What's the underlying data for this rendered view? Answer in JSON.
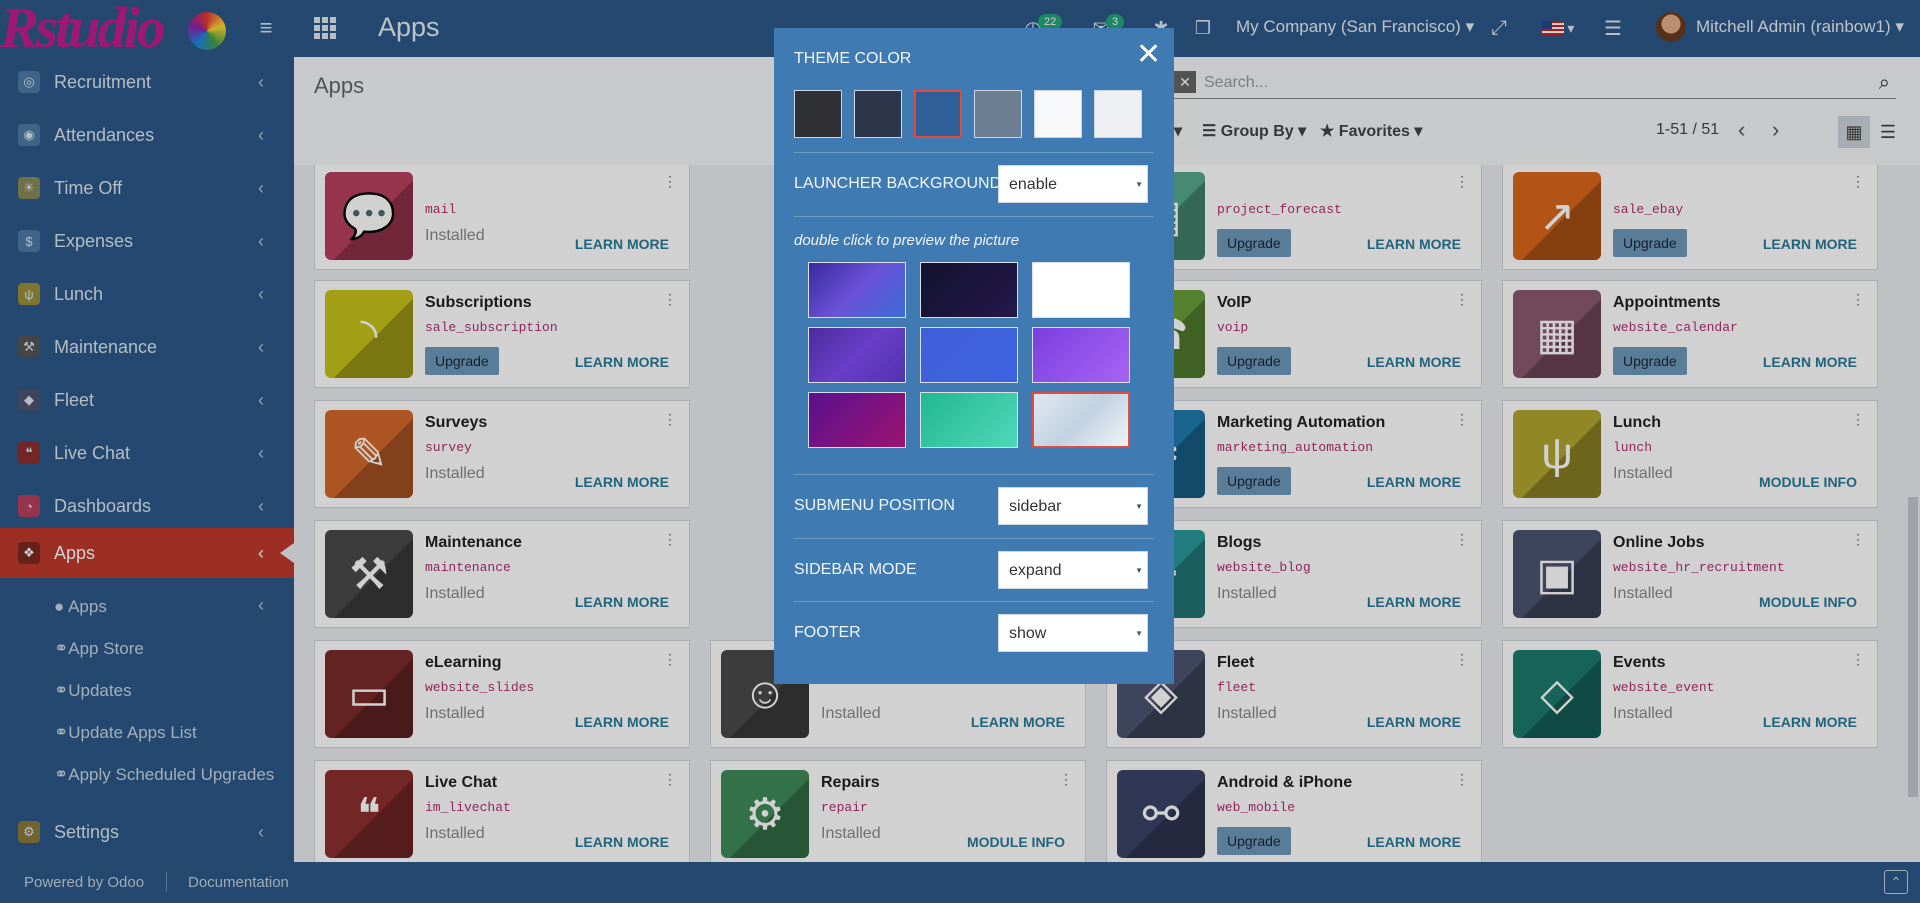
{
  "topbar": {
    "title": "Apps",
    "activity_count": "22",
    "messages_count": "3",
    "company": "My Company (San Francisco)",
    "user": "Mitchell Admin (rainbow1)",
    "logo_text": "Rstudio"
  },
  "sidebar": {
    "items": [
      {
        "label": "Recruitment",
        "icon": "recruitment-icon"
      },
      {
        "label": "Attendances",
        "icon": "attendances-icon"
      },
      {
        "label": "Time Off",
        "icon": "time-off-icon"
      },
      {
        "label": "Expenses",
        "icon": "expenses-icon"
      },
      {
        "label": "Lunch",
        "icon": "lunch-icon"
      },
      {
        "label": "Maintenance",
        "icon": "maintenance-icon"
      },
      {
        "label": "Fleet",
        "icon": "fleet-icon"
      },
      {
        "label": "Live Chat",
        "icon": "live-chat-icon"
      },
      {
        "label": "Dashboards",
        "icon": "dashboards-icon"
      },
      {
        "label": "Apps",
        "icon": "apps-icon"
      }
    ],
    "sub_items": [
      "Apps",
      "App Store",
      "Updates",
      "Update Apps List",
      "Apply Scheduled Upgrades"
    ],
    "settings": "Settings"
  },
  "control_panel": {
    "breadcrumb": "Apps",
    "search_placeholder": "Search...",
    "group_by": "Group By",
    "favorites": "Favorites",
    "pager": "1-51 / 51"
  },
  "apps": [
    {
      "name": "",
      "tech": "mail",
      "status": "Installed",
      "action": "LEARN MORE",
      "color": "#b83f5e",
      "icon": "chat-bubble-icon"
    },
    {
      "name": "",
      "tech": "project_forecast",
      "status": "Upgrade",
      "action": "LEARN MORE",
      "color": "#56a88e",
      "icon": "forecast-icon"
    },
    {
      "name": "",
      "tech": "sale_ebay",
      "status": "Upgrade",
      "action": "LEARN MORE",
      "color": "#d9671b",
      "icon": "chart-up-icon"
    },
    {
      "name": "Subscriptions",
      "tech": "sale_subscription",
      "status": "Upgrade",
      "action": "LEARN MORE",
      "color": "#c7c21a",
      "icon": "rss-icon"
    },
    {
      "name": "VoIP",
      "tech": "voip",
      "status": "Upgrade",
      "action": "LEARN MORE",
      "color": "#6a9f3a",
      "icon": "phone-icon"
    },
    {
      "name": "Appointments",
      "tech": "website_calendar",
      "status": "Upgrade",
      "action": "LEARN MORE",
      "color": "#8c5a6e",
      "icon": "calendar-clock-icon"
    },
    {
      "name": "Surveys",
      "tech": "survey",
      "status": "Installed",
      "action": "LEARN MORE",
      "color": "#d46a2d",
      "icon": "survey-icon"
    },
    {
      "name": "Marketing Automation",
      "tech": "marketing_automation",
      "status": "Upgrade",
      "action": "LEARN MORE",
      "color": "#1f7bab",
      "icon": "gear-icon"
    },
    {
      "name": "Lunch",
      "tech": "lunch",
      "status": "Installed",
      "action": "MODULE INFO",
      "color": "#b3a52f",
      "icon": "cutlery-icon"
    },
    {
      "name": "Maintenance",
      "tech": "maintenance",
      "status": "Installed",
      "action": "LEARN MORE",
      "color": "#4a4a4a",
      "icon": "hammer-icon"
    },
    {
      "name": "Blogs",
      "tech": "website_blog",
      "status": "Installed",
      "action": "LEARN MORE",
      "color": "#2a9a9a",
      "icon": "blog-icon"
    },
    {
      "name": "Online Jobs",
      "tech": "website_hr_recruitment",
      "status": "Installed",
      "action": "MODULE INFO",
      "color": "#4c5470",
      "icon": "briefcase-icon"
    },
    {
      "name": "eLearning",
      "tech": "website_slides",
      "status": "Installed",
      "action": "LEARN MORE",
      "color": "#7a2b2b",
      "icon": "presentation-icon"
    },
    {
      "name": "",
      "tech": "",
      "status": "Installed",
      "action": "LEARN MORE",
      "color": "#4a4a4a",
      "icon": "user-chat-icon"
    },
    {
      "name": "Fleet",
      "tech": "fleet",
      "status": "Installed",
      "action": "LEARN MORE",
      "color": "#4c5470",
      "icon": "car-icon"
    },
    {
      "name": "Events",
      "tech": "website_event",
      "status": "Installed",
      "action": "LEARN MORE",
      "color": "#1b7a6e",
      "icon": "ticket-icon"
    },
    {
      "name": "Live Chat",
      "tech": "im_livechat",
      "status": "Installed",
      "action": "LEARN MORE",
      "color": "#8c2f2f",
      "icon": "live-chat-icon"
    },
    {
      "name": "Repairs",
      "tech": "repair",
      "status": "Installed",
      "action": "MODULE INFO",
      "color": "#3f8c5a",
      "icon": "wrench-gear-icon"
    },
    {
      "name": "Android & iPhone",
      "tech": "web_mobile",
      "status": "Upgrade",
      "action": "LEARN MORE",
      "color": "#3a4468",
      "icon": "handshake-icon"
    }
  ],
  "theme_panel": {
    "theme_color_label": "THEME COLOR",
    "swatches": [
      "#2f3033",
      "#2c3549",
      "#2f5f97",
      "#6c7e92",
      "#f7f8fa",
      "#eef0f3"
    ],
    "launcher_label": "LAUNCHER BACKGROUND",
    "launcher_value": "enable",
    "hint": "double click to preview the picture",
    "backgrounds": [
      "linear-gradient(135deg,#3a2a9e,#6a52d8 50%,#3b6bd6)",
      "linear-gradient(135deg,#12122e,#24184a)",
      "linear-gradient(135deg,#ffffff,#ffffff)",
      "linear-gradient(135deg,#4b2b9e,#6a3ec8 50%,#5233b0)",
      "linear-gradient(135deg,#3f5fd8,#3e63e0)",
      "linear-gradient(135deg,#7b3fe0,#a764f2)",
      "linear-gradient(135deg,#5a1090,#9a1470)",
      "linear-gradient(135deg,#22b890,#4fd8b8)",
      "linear-gradient(135deg,#dfe8f0,#c2d2e2 50%,#eef4f8)"
    ],
    "submenu_label": "SUBMENU POSITION",
    "submenu_value": "sidebar",
    "sidebar_mode_label": "SIDEBAR MODE",
    "sidebar_mode_value": "expand",
    "footer_label": "FOOTER",
    "footer_value": "show"
  },
  "footer": {
    "powered": "Powered by Odoo",
    "documentation": "Documentation"
  }
}
